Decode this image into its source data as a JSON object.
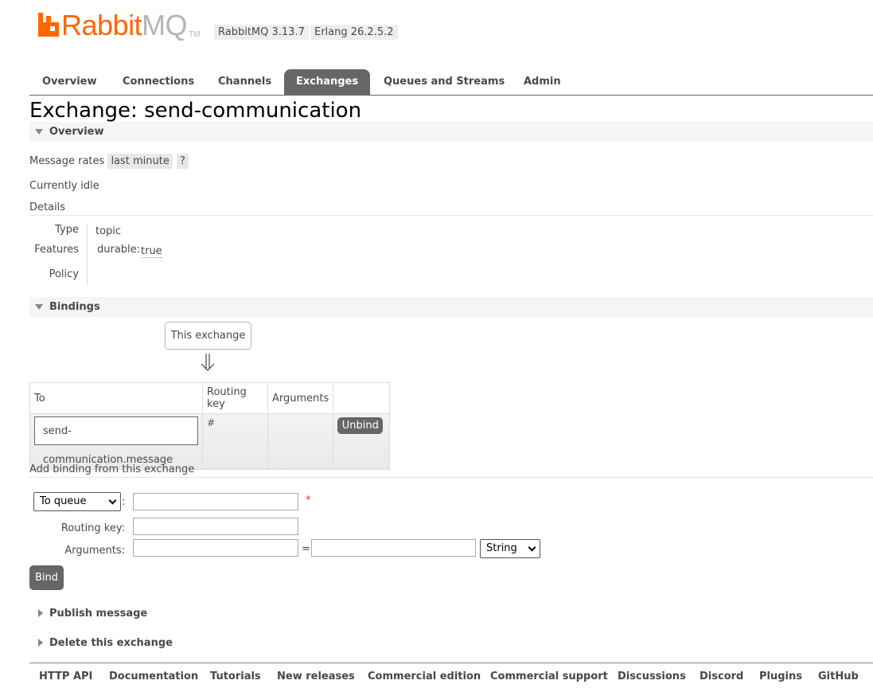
{
  "brand": {
    "rabbit": "Rabbit",
    "mq": "MQ",
    "tm": "TM",
    "accent": "#ff6600"
  },
  "versions": {
    "rabbitmq": "RabbitMQ 3.13.7",
    "erlang": "Erlang 26.2.5.2"
  },
  "tabs": [
    {
      "label": "Overview"
    },
    {
      "label": "Connections"
    },
    {
      "label": "Channels"
    },
    {
      "label": "Exchanges",
      "active": true
    },
    {
      "label": "Queues and Streams"
    },
    {
      "label": "Admin"
    }
  ],
  "page": {
    "title_prefix": "Exchange:",
    "title_name": "send-communication"
  },
  "overview": {
    "header": "Overview",
    "message_rates_label": "Message rates",
    "message_rates_range": "last minute",
    "help": "?",
    "status": "Currently idle",
    "details_label": "Details",
    "type_key": "Type",
    "type_value": "topic",
    "features_key": "Features",
    "features_durable_key": "durable:",
    "features_durable_value": "true",
    "policy_key": "Policy"
  },
  "bindings": {
    "header": "Bindings",
    "this_exchange": "This exchange",
    "columns": {
      "to": "To",
      "routing_key": "Routing key",
      "arguments": "Arguments"
    },
    "rows": [
      {
        "to": "send-communication.message",
        "routing_key": "#",
        "arguments": "",
        "action": "Unbind"
      }
    ]
  },
  "add_binding": {
    "title": "Add binding from this exchange",
    "destination_select": "To queue",
    "colon": ":",
    "required": "*",
    "routing_key_label": "Routing key:",
    "arguments_label": "Arguments:",
    "equals": "=",
    "type_select": "String",
    "bind_button": "Bind"
  },
  "collapsed_sections": {
    "publish": "Publish message",
    "delete": "Delete this exchange"
  },
  "footer": [
    "HTTP API",
    "Documentation",
    "Tutorials",
    "New releases",
    "Commercial edition",
    "Commercial support",
    "Discussions",
    "Discord",
    "Plugins",
    "GitHub"
  ]
}
